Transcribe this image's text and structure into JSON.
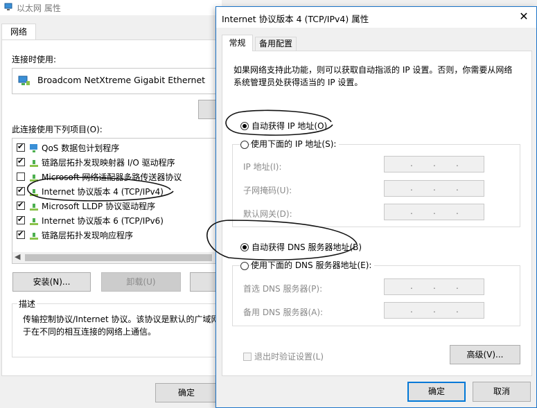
{
  "back_window": {
    "title": "以太网 属性",
    "tab": "网络",
    "connect_using_label": "连接时使用:",
    "adapter_name": "Broadcom NetXtreme Gigabit Ethernet",
    "items_label": "此连接使用下列项目(O):",
    "items": [
      {
        "label": "QoS 数据包计划程序",
        "checked": true
      },
      {
        "label": "链路层拓扑发现映射器 I/O 驱动程序",
        "checked": true
      },
      {
        "label": "Microsoft 网络适配器多路传送器协议",
        "checked": false
      },
      {
        "label": "Internet 协议版本 4 (TCP/IPv4)",
        "checked": true
      },
      {
        "label": "Microsoft LLDP 协议驱动程序",
        "checked": true
      },
      {
        "label": "Internet 协议版本 6 (TCP/IPv6)",
        "checked": true
      },
      {
        "label": "链路层拓扑发现响应程序",
        "checked": true
      }
    ],
    "install_label": "安装(N)...",
    "uninstall_label": "卸载(U)",
    "description_label": "描述",
    "description_text": "传输控制协议/Internet 协议。该协议是默认的广域网",
    "description_text_2": "于在不同的相互连接的网络上通信。",
    "ok_label": "确定"
  },
  "front_window": {
    "title": "Internet 协议版本 4 (TCP/IPv4) 属性",
    "close_glyph": "✕",
    "tabs": [
      "常规",
      "备用配置"
    ],
    "intro_text": "如果网络支持此功能，则可以获取自动指派的 IP 设置。否则，你需要从网络系统管理员处获得适当的 IP 设置。",
    "auto_ip_label": "自动获得 IP 地址(O)",
    "manual_ip_label": "使用下面的 IP 地址(S):",
    "ip_address_label": "IP 地址(I):",
    "subnet_label": "子网掩码(U):",
    "gateway_label": "默认网关(D):",
    "auto_dns_label": "自动获得 DNS 服务器地址(B)",
    "manual_dns_label": "使用下面的 DNS 服务器地址(E):",
    "preferred_dns_label": "首选 DNS 服务器(P):",
    "alternate_dns_label": "备用 DNS 服务器(A):",
    "validate_label": "退出时验证设置(L)",
    "advanced_label": "高级(V)...",
    "ok_label": "确定",
    "cancel_label": "取消",
    "ip_placeholder_dots": ".",
    "auto_ip_selected": true,
    "auto_dns_selected": true
  },
  "colors": {
    "accent": "#0078d7",
    "disabled_text": "#8a8a8a",
    "ink": "#000000"
  }
}
